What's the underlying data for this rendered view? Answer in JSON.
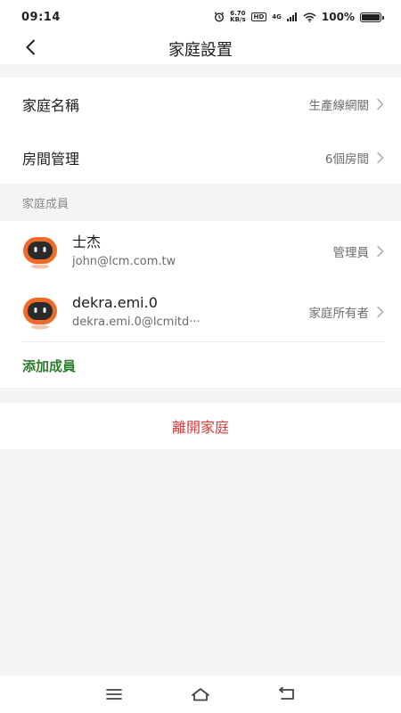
{
  "status_bar": {
    "time": "09:14",
    "speed_value": "6.70",
    "speed_unit": "KB/s",
    "hd": "HD",
    "network": "4G",
    "battery_pct": "100%"
  },
  "header": {
    "title": "家庭設置",
    "back_icon": "chevron-left-icon"
  },
  "settings": {
    "home_name": {
      "label": "家庭名稱",
      "value": "生產線網關"
    },
    "room_management": {
      "label": "房間管理",
      "value": "6個房間"
    }
  },
  "members_section": {
    "title": "家庭成員",
    "members": [
      {
        "name": "士杰",
        "email": "john@lcm.com.tw",
        "role": "管理員"
      },
      {
        "name": "dekra.emi.0",
        "email": "dekra.emi.0@lcmitd···",
        "role": "家庭所有者"
      }
    ],
    "add_label": "添加成員"
  },
  "leave": {
    "label": "離開家庭"
  },
  "colors": {
    "accent_green": "#2e7d2e",
    "danger_red": "#d93b3b",
    "avatar_orange": "#f06a2a"
  },
  "nav_bar": {
    "menu_icon": "menu-icon",
    "home_icon": "home-icon",
    "back_icon": "back-icon"
  }
}
